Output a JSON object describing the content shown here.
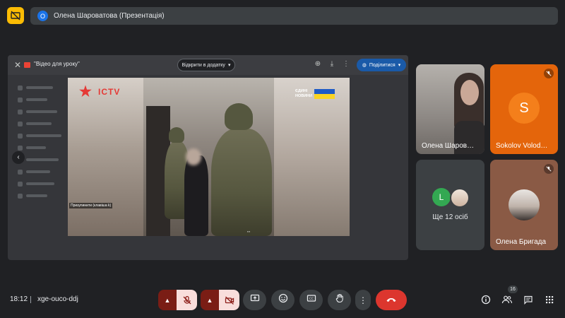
{
  "presenter": {
    "avatar_initial": "О",
    "label": "Олена Шароватова (Презентація)"
  },
  "drive": {
    "file_title": "\"Відео для уроку\"",
    "open_with_label": "Відкрити в додатку",
    "share_label": "Поділитися"
  },
  "video": {
    "channel_logo": "ICTV",
    "news_badge_line1": "ЄДИНІ",
    "news_badge_line2": "НОВИНИ",
    "caption": "Призупинити (клавіша k)"
  },
  "participants": [
    {
      "name": "Олена Шаров…",
      "muted": false
    },
    {
      "name": "Sokolov Volod…",
      "avatar_initial": "S",
      "muted": true,
      "avatar_color": "#f47f1b"
    },
    {
      "others_initial": "L",
      "others_label": "Ще 12 осіб"
    },
    {
      "name": "Олена Бригада",
      "muted": true
    }
  ],
  "footer": {
    "time": "18:12",
    "meeting_code": "xge-ouco-ddj",
    "people_count": "16"
  },
  "colors": {
    "accent_red": "#dc362e",
    "muted_bg": "#f9dedc",
    "presenter_yellow": "#fbbc04"
  }
}
